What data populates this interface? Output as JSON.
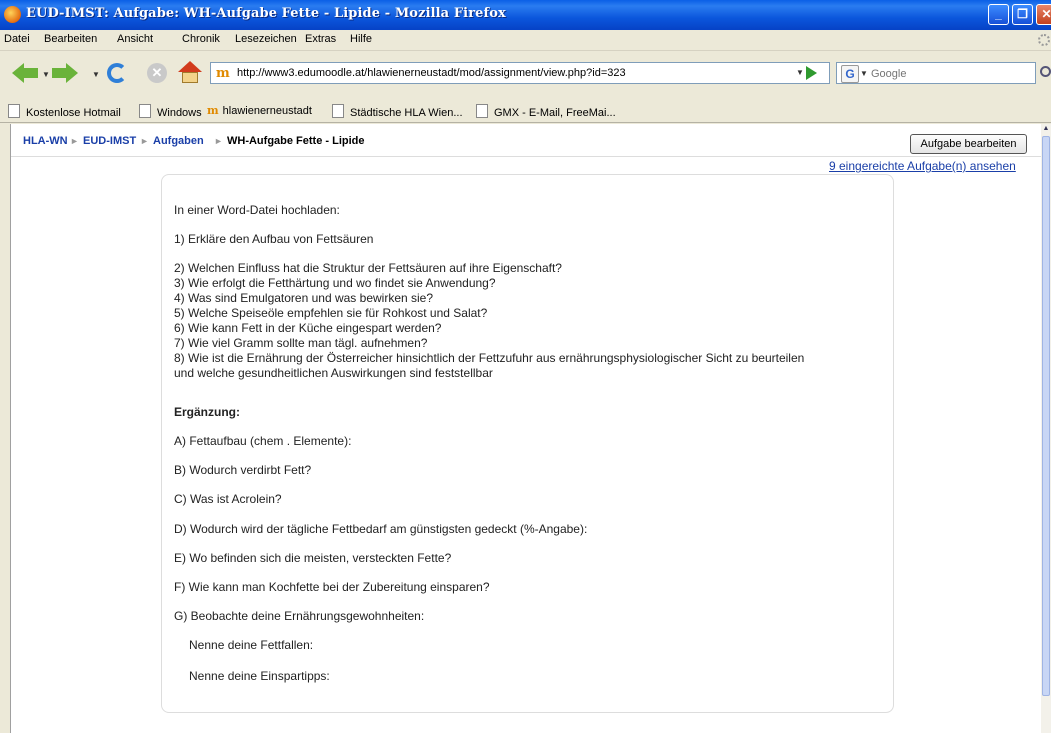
{
  "window": {
    "title": "EUD-IMST: Aufgabe: WH-Aufgabe Fette - Lipide - Mozilla Firefox",
    "controls": {
      "minimize": "_",
      "maximize": "❐",
      "close": "✕"
    }
  },
  "menu": [
    "Datei",
    "Bearbeiten",
    "Ansicht",
    "Chronik",
    "Lesezeichen",
    "Extras",
    "Hilfe"
  ],
  "toolbar": {
    "url": "http://www3.edumoodle.at/hlawienerneustadt/mod/assignment/view.php?id=323",
    "search_placeholder": "Google",
    "search_engine_glyph": "G",
    "favicon_glyph": "m",
    "stop_glyph": "✕"
  },
  "bookmarks": [
    "Kostenlose Hotmail",
    "Windows",
    "hlawienerneustadt",
    "Städtische HLA Wien...",
    "GMX - E-Mail, FreeMai..."
  ],
  "breadcrumb": {
    "items": [
      "HLA-WN",
      "EUD-IMST",
      "Aufgaben",
      "WH-Aufgabe Fette - Lipide"
    ],
    "separator": "►"
  },
  "actions": {
    "edit_button": "Aufgabe bearbeiten",
    "submissions_link": "9 eingereichte Aufgabe(n) ansehen"
  },
  "assignment": {
    "intro": "In einer Word-Datei hochladen:",
    "q1": "1) Erkläre den Aufbau von Fettsäuren",
    "questions": [
      "2) Welchen Einfluss hat die Struktur der Fettsäuren auf ihre Eigenschaft?",
      "3) Wie erfolgt die Fetthärtung und wo findet sie Anwendung?",
      "4) Was sind Emulgatoren und was bewirken sie?",
      "5) Welche Speiseöle empfehlen sie für Rohkost und Salat?",
      "6) Wie kann Fett in der Küche eingespart werden?",
      "7)  Wie viel Gramm sollte man tägl. aufnehmen?",
      "8) Wie ist die Ernährung der Österreicher hinsichtlich der Fettzufuhr aus ernährungsphysiologischer Sicht zu beurteilen",
      "und welche gesundheitlichen Auswirkungen sind feststellbar"
    ],
    "supplement_heading": "Ergänzung:",
    "supplement": [
      "A) Fettaufbau (chem . Elemente):",
      "B) Wodurch verdirbt Fett?",
      "C) Was ist Acrolein?",
      "D) Wodurch wird der tägliche Fettbedarf am günstigsten gedeckt (%-Angabe):",
      "E) Wo befinden sich die meisten, versteckten Fette?",
      "F) Wie kann man Kochfette bei der Zubereitung einsparen?",
      "G) Beobachte deine Ernährungsgewohnheiten:"
    ],
    "sub_items": [
      "Nenne deine Fettfallen:",
      "Nenne deine Einspartipps:"
    ]
  }
}
